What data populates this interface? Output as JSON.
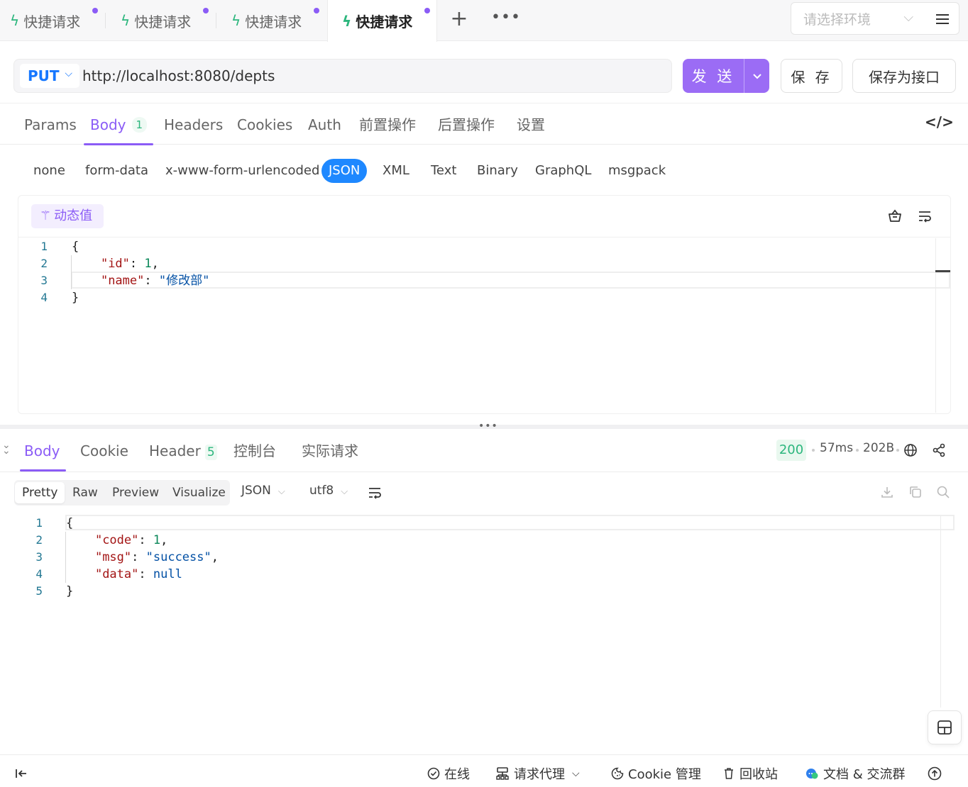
{
  "tabs": [
    {
      "label": "快捷请求",
      "active": false
    },
    {
      "label": "快捷请求",
      "active": false
    },
    {
      "label": "快捷请求",
      "active": false
    },
    {
      "label": "快捷请求",
      "active": true
    }
  ],
  "tab_actions": {
    "add": "+",
    "more": "•••"
  },
  "environment": {
    "placeholder": "请选择环境"
  },
  "request": {
    "method": "PUT",
    "url": "http://localhost:8080/depts",
    "send_label": "发 送",
    "save_label": "保 存",
    "save_as_label": "保存为接口"
  },
  "request_tabs": [
    {
      "label": "Params"
    },
    {
      "label": "Body",
      "badge": "1",
      "active": true
    },
    {
      "label": "Headers"
    },
    {
      "label": "Cookies"
    },
    {
      "label": "Auth"
    },
    {
      "label": "前置操作"
    },
    {
      "label": "后置操作"
    },
    {
      "label": "设置"
    }
  ],
  "body_types": [
    "none",
    "form-data",
    "x-www-form-urlencoded",
    "JSON",
    "XML",
    "Text",
    "Binary",
    "GraphQL",
    "msgpack"
  ],
  "body_type_selected": "JSON",
  "dynamic_value_label": "动态值",
  "request_body_lines": [
    {
      "n": "1",
      "parts": [
        {
          "t": "{",
          "c": "p"
        }
      ]
    },
    {
      "n": "2",
      "parts": [
        {
          "t": "    ",
          "c": "p"
        },
        {
          "t": "\"id\"",
          "c": "key"
        },
        {
          "t": ": ",
          "c": "p"
        },
        {
          "t": "1",
          "c": "num"
        },
        {
          "t": ",",
          "c": "p"
        }
      ]
    },
    {
      "n": "3",
      "parts": [
        {
          "t": "    ",
          "c": "p"
        },
        {
          "t": "\"name\"",
          "c": "key"
        },
        {
          "t": ": ",
          "c": "p"
        },
        {
          "t": "\"修改部\"",
          "c": "str"
        }
      ]
    },
    {
      "n": "4",
      "parts": [
        {
          "t": "}",
          "c": "p"
        }
      ]
    }
  ],
  "response_tabs": [
    {
      "label": "Body",
      "active": true
    },
    {
      "label": "Cookie"
    },
    {
      "label": "Header",
      "badge": "5"
    },
    {
      "label": "控制台"
    },
    {
      "label": "实际请求"
    }
  ],
  "response_meta": {
    "status": "200",
    "time": "57ms",
    "size": "202B"
  },
  "response_views": [
    "Pretty",
    "Raw",
    "Preview",
    "Visualize"
  ],
  "response_view_selected": "Pretty",
  "response_format": "JSON",
  "response_encoding": "utf8",
  "response_body_lines": [
    {
      "n": "1",
      "parts": [
        {
          "t": "{",
          "c": "p"
        }
      ]
    },
    {
      "n": "2",
      "parts": [
        {
          "t": "    ",
          "c": "p"
        },
        {
          "t": "\"code\"",
          "c": "key"
        },
        {
          "t": ": ",
          "c": "p"
        },
        {
          "t": "1",
          "c": "num"
        },
        {
          "t": ",",
          "c": "p"
        }
      ]
    },
    {
      "n": "3",
      "parts": [
        {
          "t": "    ",
          "c": "p"
        },
        {
          "t": "\"msg\"",
          "c": "key"
        },
        {
          "t": ": ",
          "c": "p"
        },
        {
          "t": "\"success\"",
          "c": "str"
        },
        {
          "t": ",",
          "c": "p"
        }
      ]
    },
    {
      "n": "4",
      "parts": [
        {
          "t": "    ",
          "c": "p"
        },
        {
          "t": "\"data\"",
          "c": "key"
        },
        {
          "t": ": ",
          "c": "p"
        },
        {
          "t": "null",
          "c": "null"
        }
      ]
    },
    {
      "n": "5",
      "parts": [
        {
          "t": "}",
          "c": "p"
        }
      ]
    }
  ],
  "status_bar": {
    "online": "在线",
    "proxy": "请求代理",
    "cookie_manager": "Cookie 管理",
    "recycle_bin": "回收站",
    "docs_group": "文档 & 交流群"
  },
  "colors": {
    "accent": "#8b5cf6",
    "method": "#1677ff",
    "json_active": "#1e88ff",
    "success": "#2cb67d"
  }
}
